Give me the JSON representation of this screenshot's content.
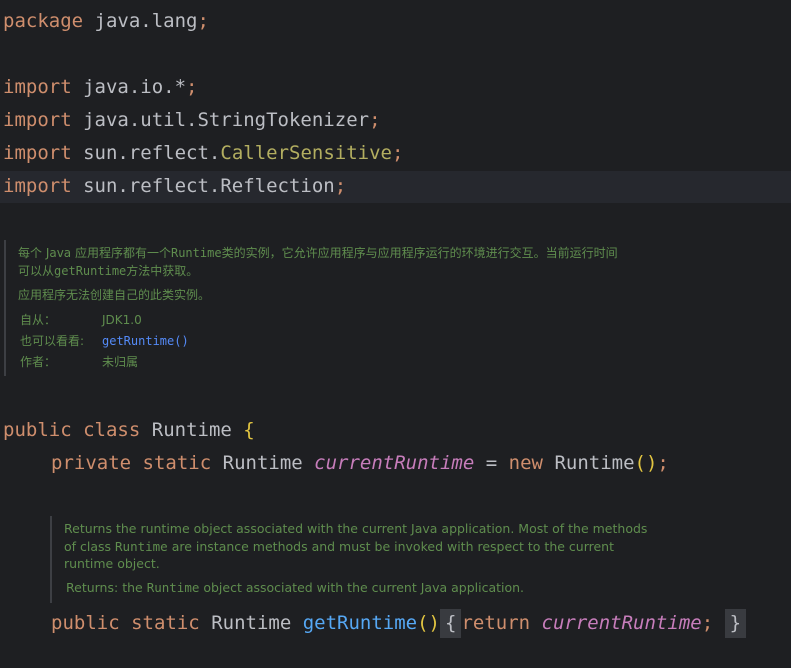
{
  "code": {
    "package_line": {
      "kw": "package",
      "name": "java.lang",
      "semi": ";"
    },
    "imports": [
      {
        "kw": "import",
        "plain": "java.io.*",
        "ann": "",
        "tail": "",
        "semi": ";"
      },
      {
        "kw": "import",
        "plain": "java.util.StringTokenizer",
        "ann": "",
        "tail": "",
        "semi": ";"
      },
      {
        "kw": "import",
        "plain": "sun.reflect.",
        "ann": "CallerSensitive",
        "tail": "",
        "semi": ";"
      },
      {
        "kw": "import",
        "plain": "sun.reflect.Reflection",
        "ann": "",
        "tail": "",
        "semi": ";"
      }
    ],
    "class_decl": {
      "mod": "public",
      "kw": "class",
      "name": "Runtime",
      "brace": "{"
    },
    "field_decl": {
      "mod1": "private",
      "mod2": "static",
      "type": "Runtime",
      "name": "currentRuntime",
      "eq": "=",
      "kw_new": "new",
      "ctor": "Runtime",
      "parens": "()",
      "semi": ";"
    },
    "method_decl": {
      "mod1": "public",
      "mod2": "static",
      "type": "Runtime",
      "name": "getRuntime",
      "parens": "()",
      "open": "{",
      "kw_return": "return",
      "ret": "currentRuntime",
      "semi": ";",
      "close": "}"
    }
  },
  "doc_class": {
    "line1a": "每个 Java 应用程序都有一个",
    "line1code": "Runtime",
    "line1b": "类的实例，它允许应用程序与应用程序运行的环境进行交互。当前运行时间",
    "line2a": "可以从",
    "line2code": "getRuntime",
    "line2b": "方法中获取。",
    "line3": "应用程序无法创建自己的此类实例。",
    "tags": [
      {
        "label": "自从：",
        "value": "JDK1.0",
        "link": false
      },
      {
        "label": "也可以看看:",
        "value": "getRuntime()",
        "link": true
      },
      {
        "label": "作者：",
        "value": "未归属",
        "link": false
      }
    ]
  },
  "doc_method": {
    "line1": "Returns the runtime object associated with the current Java application. Most of the methods",
    "line2a": "of class ",
    "line2code": "Runtime",
    "line2b": " are instance methods and must be invoked with respect to the current",
    "line3": "runtime object.",
    "returns_label": "Returns:",
    "returns_a": " the ",
    "returns_code": "Runtime",
    "returns_b": " object associated with the current Java application."
  },
  "colors": {
    "background": "#1e1f22",
    "keyword": "#cf8e6d",
    "annotation": "#b3ae60",
    "field": "#c77dbb",
    "method": "#56a8f5",
    "doc_text": "#5f8d4e",
    "link": "#548af7"
  }
}
